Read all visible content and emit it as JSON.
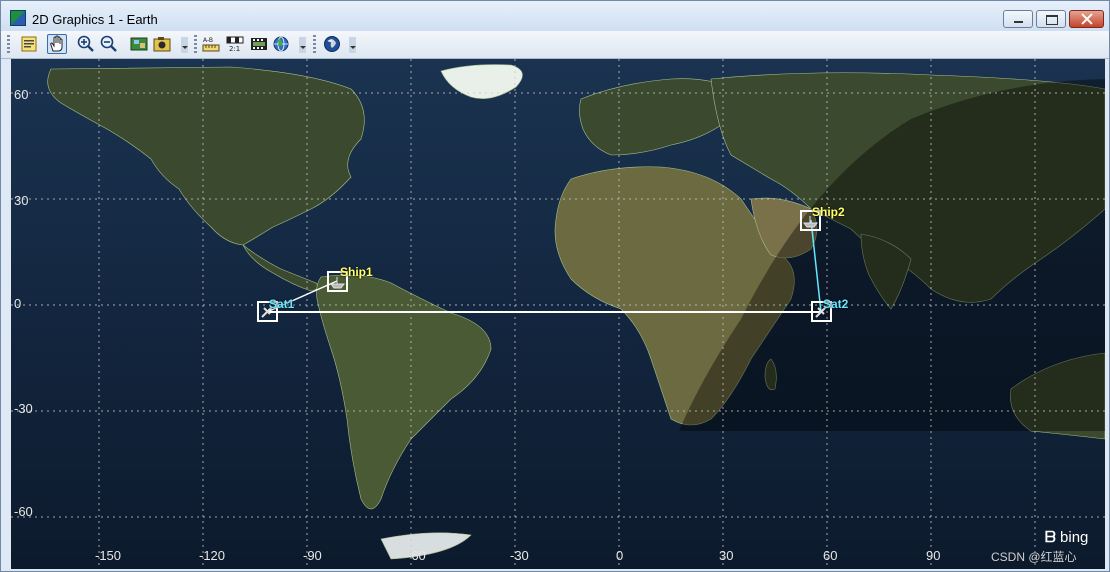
{
  "window": {
    "title": "2D Graphics 1 - Earth",
    "accent_color": "#3a6ea5"
  },
  "toolbar": {
    "buttons": [
      {
        "name": "properties-button",
        "icon": "properties-icon"
      },
      {
        "name": "pan-button",
        "icon": "hand-icon",
        "pressed": true
      },
      {
        "name": "zoom-in-button",
        "icon": "zoom-in-icon"
      },
      {
        "name": "zoom-out-button",
        "icon": "zoom-out-icon"
      },
      {
        "name": "map-layers-button",
        "icon": "map-layers-icon"
      },
      {
        "name": "snapshot-button",
        "icon": "camera-icon"
      },
      {
        "name": "measure-button",
        "icon": "ruler-icon",
        "text": "A-B"
      },
      {
        "name": "scale-button",
        "icon": "scale-icon",
        "text": "2:1"
      },
      {
        "name": "film-button",
        "icon": "film-icon"
      },
      {
        "name": "globe-button",
        "icon": "globe-icon"
      },
      {
        "name": "3d-globe-button",
        "icon": "earth-icon"
      }
    ]
  },
  "map": {
    "ocean_color": "#10233d",
    "land_color": "#3a4a2c",
    "grid_color": "#c8c8c8",
    "lat_labels": [
      "60",
      "30",
      "0",
      "-30",
      "-60"
    ],
    "lon_labels": [
      "-150",
      "-120",
      "-90",
      "-60",
      "-30",
      "0",
      "30",
      "60",
      "90"
    ],
    "objects": {
      "ship1": {
        "label": "Ship1",
        "color": "#ffff66"
      },
      "ship2": {
        "label": "Ship2",
        "color": "#ffff66"
      },
      "sat1": {
        "label": "Sat1",
        "color": "#66e6ff"
      },
      "sat2": {
        "label": "Sat2",
        "color": "#66e6ff"
      }
    },
    "link_colors": {
      "sat_link": "#ffffff",
      "ship_link": "#66e6ff"
    },
    "bing_logo": "bing",
    "watermark": "CSDN @红蓝心"
  }
}
